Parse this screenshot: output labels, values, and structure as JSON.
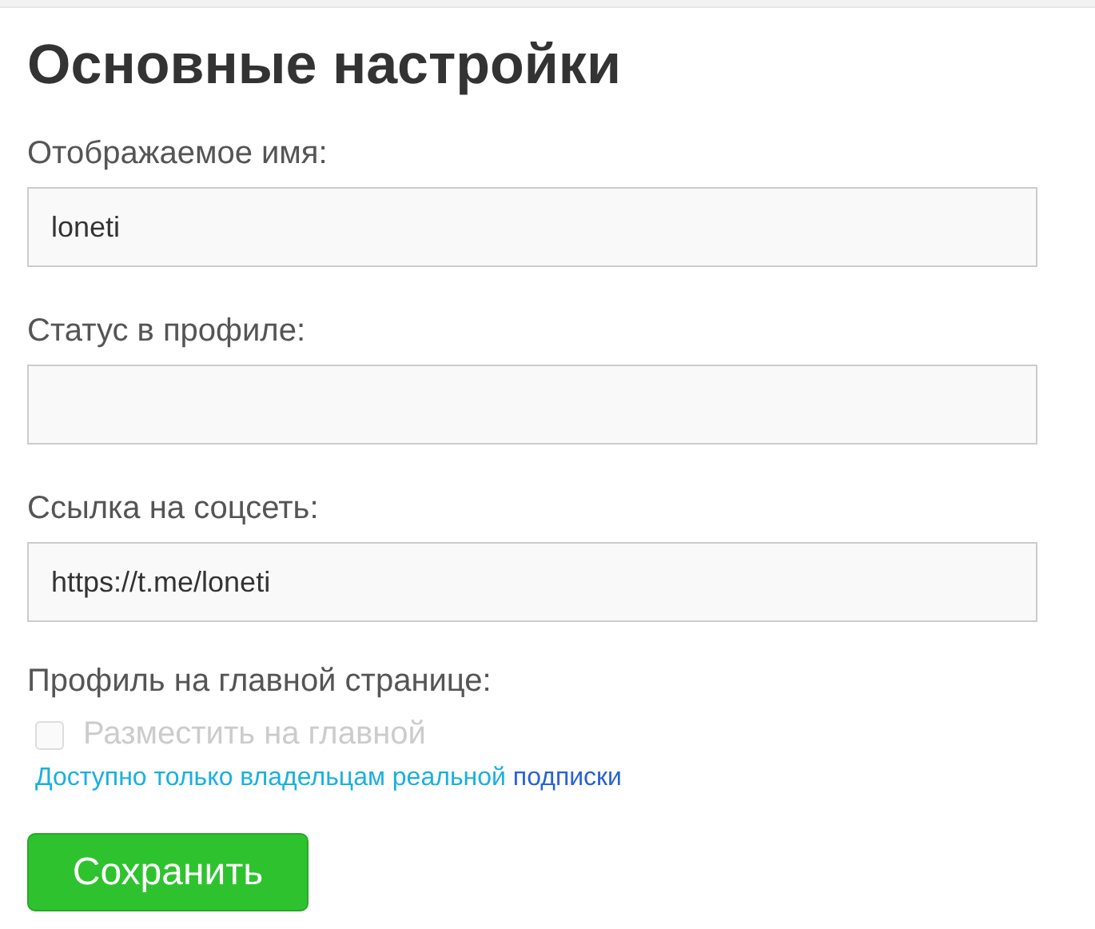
{
  "title": "Основные настройки",
  "fields": [
    {
      "label": "Отображаемое имя:",
      "value": "loneti"
    },
    {
      "label": "Статус в профиле:"
    },
    {
      "label": "Ссылка на соцсеть:",
      "value": "https://t.me/loneti"
    }
  ],
  "profile_section": {
    "label": "Профиль на главной странице:",
    "checkbox": {
      "label": "Разместить на главной",
      "checked": false,
      "disabled": true
    },
    "note": "Доступно только владельцам реальной",
    "note_link": "подписки"
  },
  "save_button": "Сохранить"
}
